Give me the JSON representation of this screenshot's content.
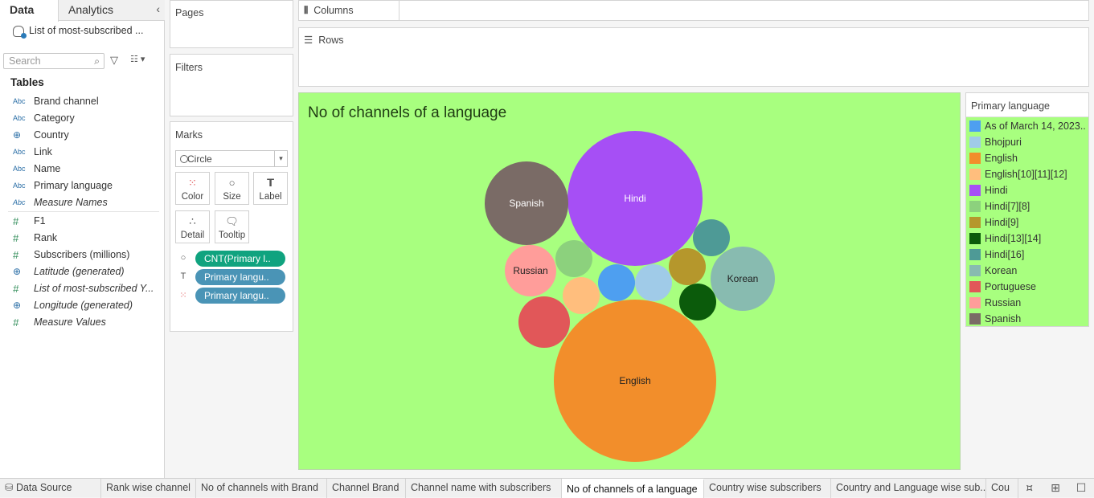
{
  "left_pane": {
    "tabs": {
      "data": "Data",
      "analytics": "Analytics"
    },
    "datasource": "List of most-subscribed ...",
    "search_placeholder": "Search",
    "tables_title": "Tables",
    "dimensions": [
      {
        "type": "Abc",
        "name": "Brand channel"
      },
      {
        "type": "Abc",
        "name": "Category"
      },
      {
        "type": "globe",
        "name": "Country"
      },
      {
        "type": "Abc",
        "name": "Link"
      },
      {
        "type": "Abc",
        "name": "Name"
      },
      {
        "type": "Abc",
        "name": "Primary language"
      },
      {
        "type": "Abc",
        "name": "Measure Names"
      }
    ],
    "measures": [
      {
        "type": "#",
        "name": "F1"
      },
      {
        "type": "#",
        "name": "Rank"
      },
      {
        "type": "#",
        "name": "Subscribers (millions)"
      },
      {
        "type": "globe",
        "name": "Latitude (generated)"
      },
      {
        "type": "#",
        "name": "List of most-subscribed Y..."
      },
      {
        "type": "globe",
        "name": "Longitude (generated)"
      },
      {
        "type": "#",
        "name": "Measure Values"
      }
    ]
  },
  "shelves": {
    "pages": "Pages",
    "filters": "Filters",
    "marks": "Marks",
    "mark_type": "Circle",
    "buttons": {
      "color": "Color",
      "size": "Size",
      "label": "Label",
      "detail": "Detail",
      "tooltip": "Tooltip"
    },
    "pills": [
      "CNT(Primary l..",
      "Primary langu..",
      "Primary langu.."
    ],
    "columns": "Columns",
    "rows": "Rows"
  },
  "chart_data": {
    "type": "bubble",
    "title": "No of channels of a language",
    "legend_title": "Primary language",
    "legend_position": "right",
    "background": "#a8ff7f",
    "bubbles": [
      {
        "label": "Hindi",
        "color": "#a64ff5",
        "text": "#ffffff",
        "show_label": true,
        "value": 22
      },
      {
        "label": "English",
        "color": "#f28e2b",
        "text": "#222222",
        "show_label": true,
        "value": 32
      },
      {
        "label": "Spanish",
        "color": "#7a6b66",
        "text": "#ffffff",
        "show_label": true,
        "value": 8
      },
      {
        "label": "Korean",
        "color": "#88bbb0",
        "text": "#222222",
        "show_label": true,
        "value": 5
      },
      {
        "label": "Russian",
        "color": "#ff9d9a",
        "text": "#222222",
        "show_label": true,
        "value": 3
      },
      {
        "label": "Portuguese",
        "color": "#e15759",
        "text": "#222222",
        "show_label": false,
        "value": 3
      },
      {
        "label": "Hindi[7][8]",
        "color": "#8cd17d",
        "text": "#222222",
        "show_label": false,
        "value": 1.5
      },
      {
        "label": "English[10][11][12]",
        "color": "#ffbe7d",
        "text": "#222222",
        "show_label": false,
        "value": 1.5
      },
      {
        "label": "As of March 14, 2023..",
        "color": "#4e9ff0",
        "text": "#222222",
        "show_label": false,
        "value": 1.5
      },
      {
        "label": "Bhojpuri",
        "color": "#a0cbe8",
        "text": "#222222",
        "show_label": false,
        "value": 1.5
      },
      {
        "label": "Hindi[9]",
        "color": "#b5972c",
        "text": "#222222",
        "show_label": false,
        "value": 1.5
      },
      {
        "label": "Hindi[16]",
        "color": "#4e9a96",
        "text": "#222222",
        "show_label": false,
        "value": 1.5
      },
      {
        "label": "Hindi[13][14]",
        "color": "#0b5b0b",
        "text": "#222222",
        "show_label": false,
        "value": 1.5
      }
    ]
  },
  "legend": [
    {
      "label": "As of March 14, 2023..",
      "color": "#4e9ff0"
    },
    {
      "label": "Bhojpuri",
      "color": "#a0cbe8"
    },
    {
      "label": "English",
      "color": "#f28e2b"
    },
    {
      "label": "English[10][11][12]",
      "color": "#ffbe7d"
    },
    {
      "label": "Hindi",
      "color": "#a64ff5"
    },
    {
      "label": "Hindi[7][8]",
      "color": "#8cd17d"
    },
    {
      "label": "Hindi[9]",
      "color": "#b5972c"
    },
    {
      "label": "Hindi[13][14]",
      "color": "#0b5b0b"
    },
    {
      "label": "Hindi[16]",
      "color": "#4e9a96"
    },
    {
      "label": "Korean",
      "color": "#88bbb0"
    },
    {
      "label": "Portuguese",
      "color": "#e15759"
    },
    {
      "label": "Russian",
      "color": "#ff9d9a"
    },
    {
      "label": "Spanish",
      "color": "#7a6b66"
    }
  ],
  "sheet_tabs": [
    {
      "label": "Data Source",
      "active": false
    },
    {
      "label": "Rank wise channel",
      "active": false
    },
    {
      "label": "No of channels with Brand",
      "active": false
    },
    {
      "label": "Channel Brand",
      "active": false
    },
    {
      "label": "Channel name with subscribers",
      "active": false
    },
    {
      "label": "No of channels of a language",
      "active": true
    },
    {
      "label": "Country wise subscribers",
      "active": false
    },
    {
      "label": "Country and Language wise sub...",
      "active": false
    },
    {
      "label": "Cou",
      "active": false
    }
  ]
}
